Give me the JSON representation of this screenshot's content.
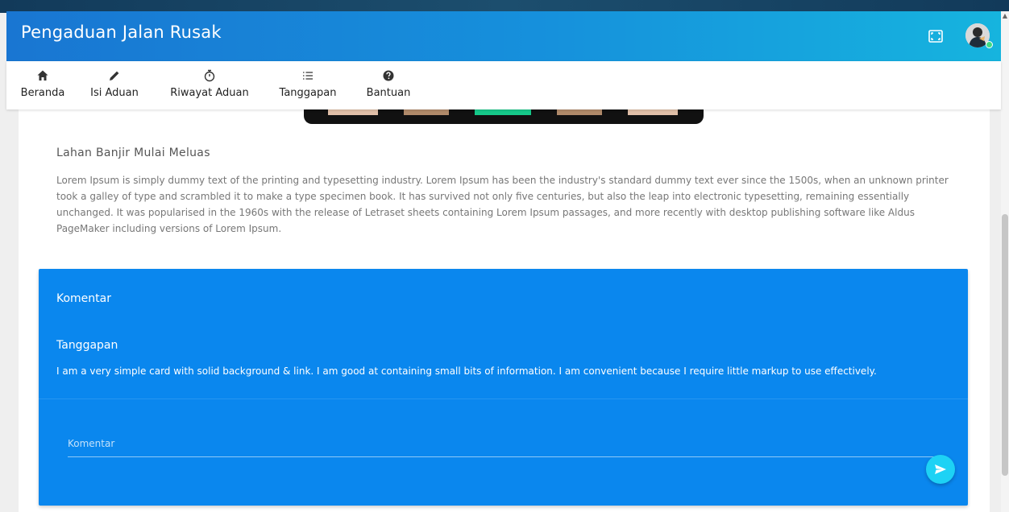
{
  "header": {
    "title": "Pengaduan Jalan Rusak",
    "fullscreen_icon": "fullscreen-icon",
    "avatar_icon": "user-avatar",
    "online_color": "#3ddc84",
    "gradient_start": "#1976d2",
    "gradient_end": "#16b4de"
  },
  "nav": {
    "items": [
      {
        "label": "Beranda",
        "icon": "home-icon"
      },
      {
        "label": "Isi Aduan",
        "icon": "pencil-icon"
      },
      {
        "label": "Riwayat Aduan",
        "icon": "stopwatch-icon"
      },
      {
        "label": "Tanggapan",
        "icon": "list-icon"
      },
      {
        "label": "Bantuan",
        "icon": "help-icon"
      }
    ]
  },
  "post": {
    "title": "Lahan Banjir Mulai Meluas",
    "body": "Lorem Ipsum is simply dummy text of the printing and typesetting industry. Lorem Ipsum has been the industry's standard dummy text ever since the 1500s, when an unknown printer took a galley of type and scrambled it to make a type specimen book. It has survived not only five centuries, but also the leap into electronic typesetting, remaining essentially unchanged. It was popularised in the 1960s with the release of Letraset sheets containing Lorem Ipsum passages, and more recently with desktop publishing software like Aldus PageMaker including versions of Lorem Ipsum."
  },
  "comments": {
    "title": "Komentar",
    "reply_title": "Tanggapan",
    "reply_text": "I am a very simple card with solid background & link. I am good at containing small bits of information. I am convenient because I require little markup to use effectively.",
    "input_placeholder": "Komentar",
    "send_icon": "send-icon",
    "card_color": "#0a87ee",
    "button_color": "#1dd2f5"
  }
}
